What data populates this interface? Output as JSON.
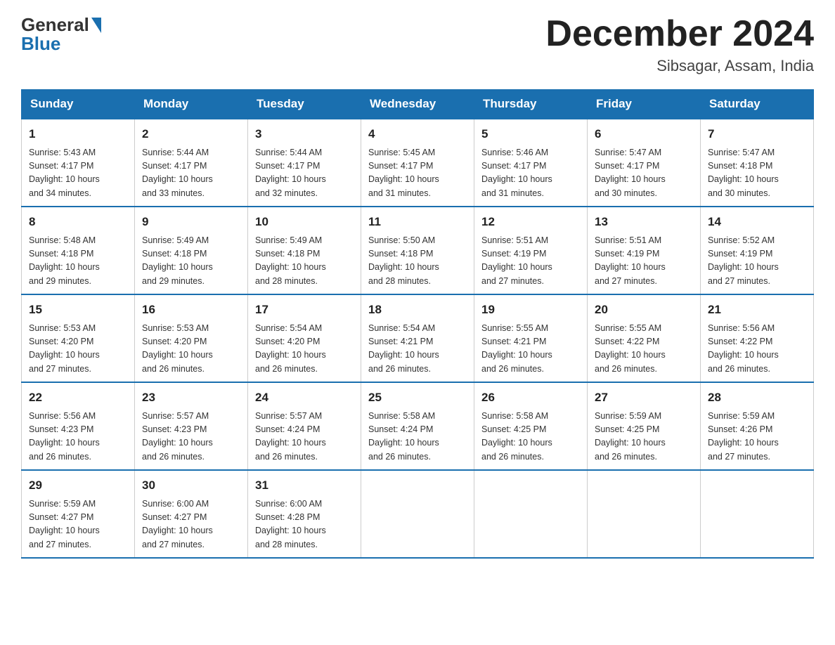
{
  "header": {
    "logo_general": "General",
    "logo_blue": "Blue",
    "month_title": "December 2024",
    "location": "Sibsagar, Assam, India"
  },
  "days": [
    "Sunday",
    "Monday",
    "Tuesday",
    "Wednesday",
    "Thursday",
    "Friday",
    "Saturday"
  ],
  "weeks": [
    [
      {
        "num": "1",
        "sunrise": "5:43 AM",
        "sunset": "4:17 PM",
        "daylight": "10 hours and 34 minutes."
      },
      {
        "num": "2",
        "sunrise": "5:44 AM",
        "sunset": "4:17 PM",
        "daylight": "10 hours and 33 minutes."
      },
      {
        "num": "3",
        "sunrise": "5:44 AM",
        "sunset": "4:17 PM",
        "daylight": "10 hours and 32 minutes."
      },
      {
        "num": "4",
        "sunrise": "5:45 AM",
        "sunset": "4:17 PM",
        "daylight": "10 hours and 31 minutes."
      },
      {
        "num": "5",
        "sunrise": "5:46 AM",
        "sunset": "4:17 PM",
        "daylight": "10 hours and 31 minutes."
      },
      {
        "num": "6",
        "sunrise": "5:47 AM",
        "sunset": "4:17 PM",
        "daylight": "10 hours and 30 minutes."
      },
      {
        "num": "7",
        "sunrise": "5:47 AM",
        "sunset": "4:18 PM",
        "daylight": "10 hours and 30 minutes."
      }
    ],
    [
      {
        "num": "8",
        "sunrise": "5:48 AM",
        "sunset": "4:18 PM",
        "daylight": "10 hours and 29 minutes."
      },
      {
        "num": "9",
        "sunrise": "5:49 AM",
        "sunset": "4:18 PM",
        "daylight": "10 hours and 29 minutes."
      },
      {
        "num": "10",
        "sunrise": "5:49 AM",
        "sunset": "4:18 PM",
        "daylight": "10 hours and 28 minutes."
      },
      {
        "num": "11",
        "sunrise": "5:50 AM",
        "sunset": "4:18 PM",
        "daylight": "10 hours and 28 minutes."
      },
      {
        "num": "12",
        "sunrise": "5:51 AM",
        "sunset": "4:19 PM",
        "daylight": "10 hours and 27 minutes."
      },
      {
        "num": "13",
        "sunrise": "5:51 AM",
        "sunset": "4:19 PM",
        "daylight": "10 hours and 27 minutes."
      },
      {
        "num": "14",
        "sunrise": "5:52 AM",
        "sunset": "4:19 PM",
        "daylight": "10 hours and 27 minutes."
      }
    ],
    [
      {
        "num": "15",
        "sunrise": "5:53 AM",
        "sunset": "4:20 PM",
        "daylight": "10 hours and 27 minutes."
      },
      {
        "num": "16",
        "sunrise": "5:53 AM",
        "sunset": "4:20 PM",
        "daylight": "10 hours and 26 minutes."
      },
      {
        "num": "17",
        "sunrise": "5:54 AM",
        "sunset": "4:20 PM",
        "daylight": "10 hours and 26 minutes."
      },
      {
        "num": "18",
        "sunrise": "5:54 AM",
        "sunset": "4:21 PM",
        "daylight": "10 hours and 26 minutes."
      },
      {
        "num": "19",
        "sunrise": "5:55 AM",
        "sunset": "4:21 PM",
        "daylight": "10 hours and 26 minutes."
      },
      {
        "num": "20",
        "sunrise": "5:55 AM",
        "sunset": "4:22 PM",
        "daylight": "10 hours and 26 minutes."
      },
      {
        "num": "21",
        "sunrise": "5:56 AM",
        "sunset": "4:22 PM",
        "daylight": "10 hours and 26 minutes."
      }
    ],
    [
      {
        "num": "22",
        "sunrise": "5:56 AM",
        "sunset": "4:23 PM",
        "daylight": "10 hours and 26 minutes."
      },
      {
        "num": "23",
        "sunrise": "5:57 AM",
        "sunset": "4:23 PM",
        "daylight": "10 hours and 26 minutes."
      },
      {
        "num": "24",
        "sunrise": "5:57 AM",
        "sunset": "4:24 PM",
        "daylight": "10 hours and 26 minutes."
      },
      {
        "num": "25",
        "sunrise": "5:58 AM",
        "sunset": "4:24 PM",
        "daylight": "10 hours and 26 minutes."
      },
      {
        "num": "26",
        "sunrise": "5:58 AM",
        "sunset": "4:25 PM",
        "daylight": "10 hours and 26 minutes."
      },
      {
        "num": "27",
        "sunrise": "5:59 AM",
        "sunset": "4:25 PM",
        "daylight": "10 hours and 26 minutes."
      },
      {
        "num": "28",
        "sunrise": "5:59 AM",
        "sunset": "4:26 PM",
        "daylight": "10 hours and 27 minutes."
      }
    ],
    [
      {
        "num": "29",
        "sunrise": "5:59 AM",
        "sunset": "4:27 PM",
        "daylight": "10 hours and 27 minutes."
      },
      {
        "num": "30",
        "sunrise": "6:00 AM",
        "sunset": "4:27 PM",
        "daylight": "10 hours and 27 minutes."
      },
      {
        "num": "31",
        "sunrise": "6:00 AM",
        "sunset": "4:28 PM",
        "daylight": "10 hours and 28 minutes."
      },
      null,
      null,
      null,
      null
    ]
  ],
  "labels": {
    "sunrise": "Sunrise:",
    "sunset": "Sunset:",
    "daylight": "Daylight:"
  }
}
